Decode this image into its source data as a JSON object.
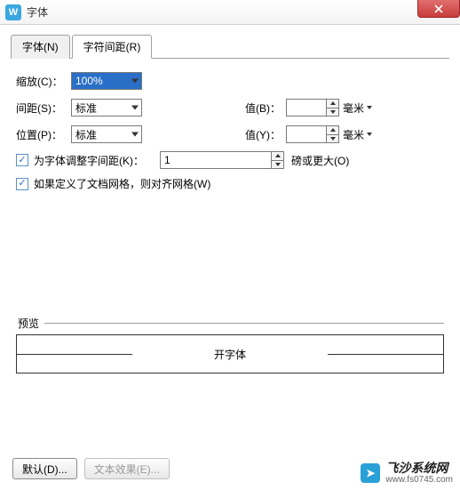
{
  "window": {
    "title": "字体"
  },
  "tabs": [
    {
      "label": "字体(N)"
    },
    {
      "label": "字符间距(R)"
    }
  ],
  "form": {
    "scale": {
      "label": "缩放(C)：",
      "value": "100%"
    },
    "spacing": {
      "label": "间距(S)：",
      "value": "标准"
    },
    "position": {
      "label": "位置(P)：",
      "value": "标准"
    },
    "valueB": {
      "label": "值(B)：",
      "value": "",
      "unit": "毫米"
    },
    "valueY": {
      "label": "值(Y)：",
      "value": "",
      "unit": "毫米"
    },
    "kerning": {
      "label": "为字体调整字间距(K)：",
      "value": "1",
      "suffix": "磅或更大(O)"
    },
    "snapgrid": {
      "label": "如果定义了文档网格，则对齐网格(W)"
    }
  },
  "preview": {
    "legend": "预览",
    "sample": "开字体"
  },
  "buttons": {
    "default": "默认(D)...",
    "texteffect": "文本效果(E)..."
  },
  "watermark": {
    "main": "飞沙系统网",
    "sub": "www.fs0745.com"
  }
}
